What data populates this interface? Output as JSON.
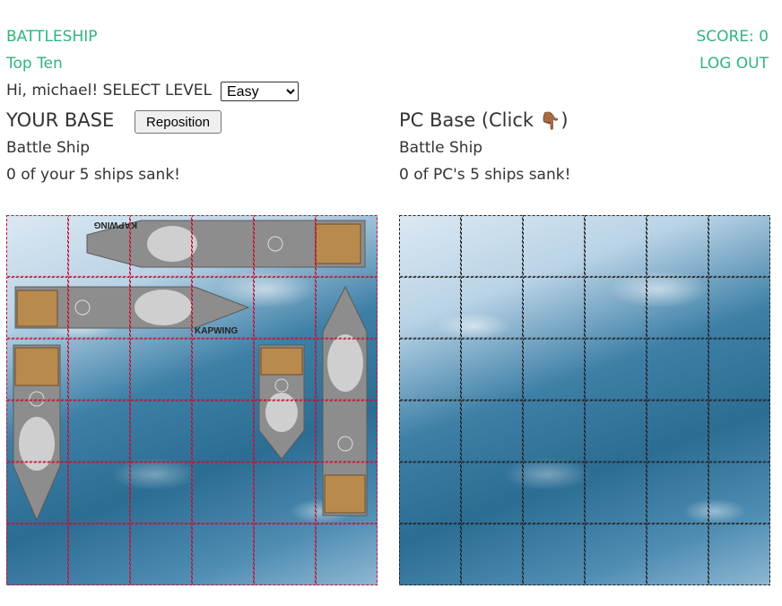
{
  "header": {
    "app_title": "BATTLESHIP",
    "score_text": "SCORE: 0",
    "top_ten_link": "Top Ten",
    "logout_link": "LOG OUT"
  },
  "greeting": "Hi, michael! SELECT LEVEL",
  "level_select": {
    "selected": "Easy",
    "options": [
      "Easy"
    ]
  },
  "player": {
    "title": "YOUR BASE",
    "reposition_label": "Reposition",
    "subtitle": "Battle Ship",
    "status": "0 of your 5 ships sank!"
  },
  "pc": {
    "title": "PC Base (Click",
    "pointer_emoji": "👇🏾",
    "title_end": ")",
    "subtitle": "Battle Ship",
    "status": "0 of PC's 5 ships sank!"
  },
  "ship_watermark": "KAPWING",
  "colors": {
    "accent": "#2fb57f",
    "player_grid": "#c8102e",
    "pc_grid": "#222222"
  }
}
